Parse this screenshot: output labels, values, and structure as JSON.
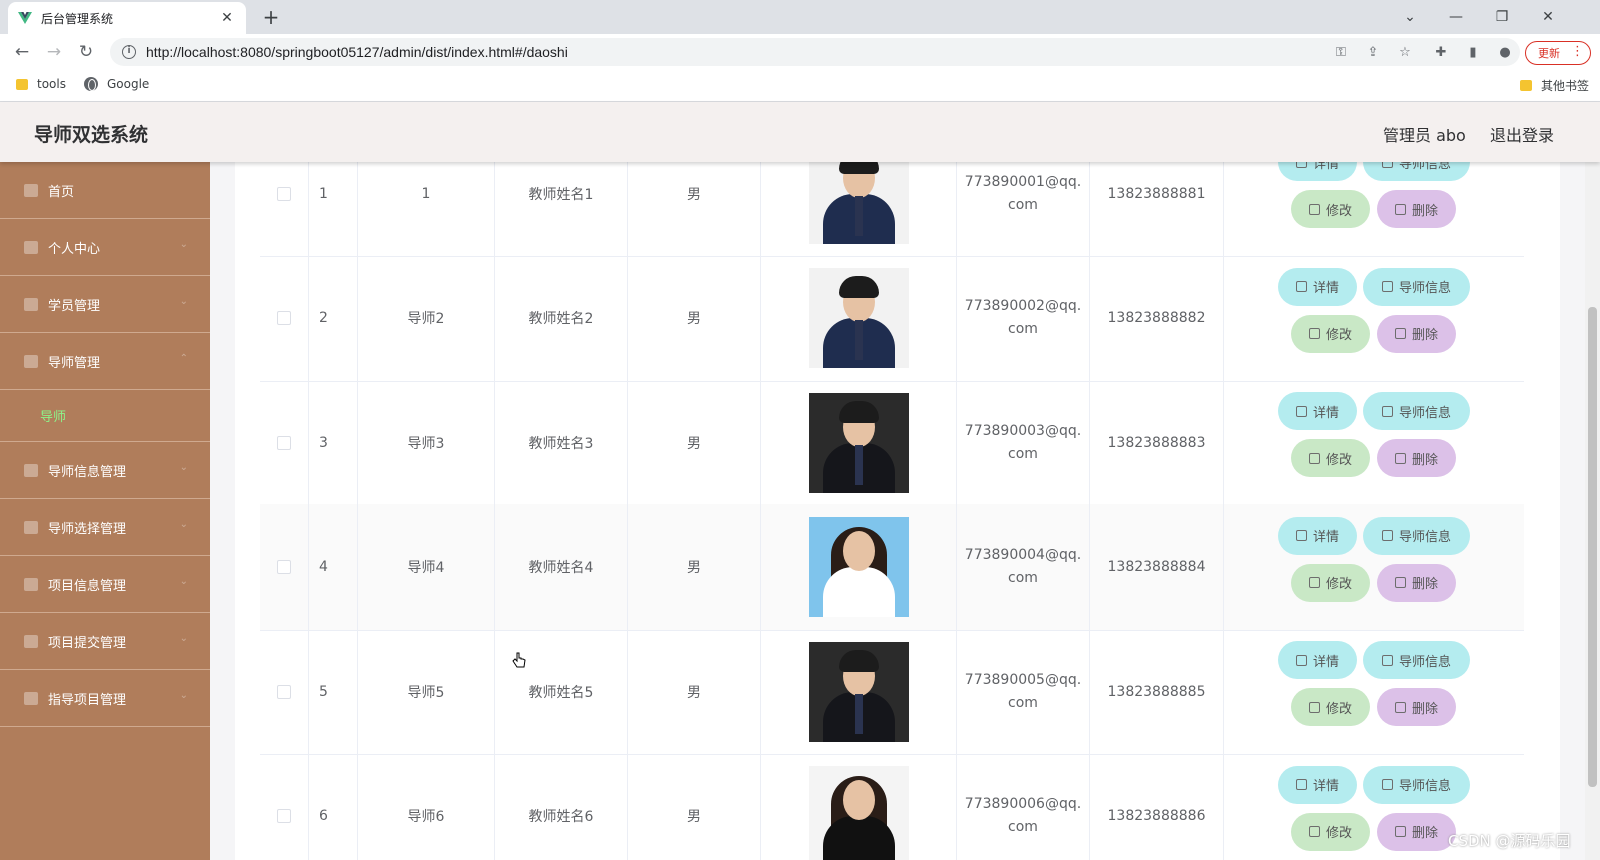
{
  "browser": {
    "tab_title": "后台管理系统",
    "tab_close": "✕",
    "new_tab": "+",
    "url": "http://localhost:8080/springboot05127/admin/dist/index.html#/daoshi",
    "update_label": "更新",
    "bookmarks": [
      "tools",
      "Google"
    ],
    "other_bookmarks": "其他书签",
    "window_controls": [
      "⌄",
      "—",
      "❐",
      "✕"
    ]
  },
  "header": {
    "title": "导师双选系统",
    "admin_label": "管理员 abo",
    "logout": "退出登录"
  },
  "sidebar": {
    "items": [
      {
        "label": "首页",
        "icon": "home-icon"
      },
      {
        "label": "个人中心",
        "icon": "user-icon"
      },
      {
        "label": "学员管理",
        "icon": "monitor-icon"
      },
      {
        "label": "导师管理",
        "icon": "clock-icon"
      },
      {
        "label": "导师",
        "icon": "",
        "sub": true
      },
      {
        "label": "导师信息管理",
        "icon": "calendar-icon"
      },
      {
        "label": "导师选择管理",
        "icon": "chat-icon"
      },
      {
        "label": "项目信息管理",
        "icon": "chart-icon"
      },
      {
        "label": "项目提交管理",
        "icon": "calendar-icon"
      },
      {
        "label": "指导项目管理",
        "icon": "crop-icon"
      }
    ]
  },
  "table": {
    "buttons": {
      "detail": "详情",
      "info": "导师信息",
      "edit": "修改",
      "delete": "删除"
    },
    "rows": [
      {
        "index": "1",
        "account": "1",
        "name": "教师姓名1",
        "gender": "男",
        "email_1": "773890001@qq.",
        "email_2": "com",
        "phone": "13823888881",
        "photo": "man-suit"
      },
      {
        "index": "2",
        "account": "导师2",
        "name": "教师姓名2",
        "gender": "男",
        "email_1": "773890002@qq.",
        "email_2": "com",
        "phone": "13823888882",
        "photo": "man-suit"
      },
      {
        "index": "3",
        "account": "导师3",
        "name": "教师姓名3",
        "gender": "男",
        "email_1": "773890003@qq.",
        "email_2": "com",
        "phone": "13823888883",
        "photo": "man-dark"
      },
      {
        "index": "4",
        "account": "导师4",
        "name": "教师姓名4",
        "gender": "男",
        "email_1": "773890004@qq.",
        "email_2": "com",
        "phone": "13823888884",
        "photo": "woman-blue"
      },
      {
        "index": "5",
        "account": "导师5",
        "name": "教师姓名5",
        "gender": "男",
        "email_1": "773890005@qq.",
        "email_2": "com",
        "phone": "13823888885",
        "photo": "man-dark"
      },
      {
        "index": "6",
        "account": "导师6",
        "name": "教师姓名6",
        "gender": "男",
        "email_1": "773890006@qq.",
        "email_2": "com",
        "phone": "13823888886",
        "photo": "woman-white"
      }
    ]
  },
  "watermark": "CSDN @源码乐园",
  "colors": {
    "sidebar": "#b07d5b",
    "active_sub": "#8df58a",
    "btn_cyan": "#b4ecef",
    "btn_green": "#c9e8c6",
    "btn_purple": "#dcc1e8"
  }
}
